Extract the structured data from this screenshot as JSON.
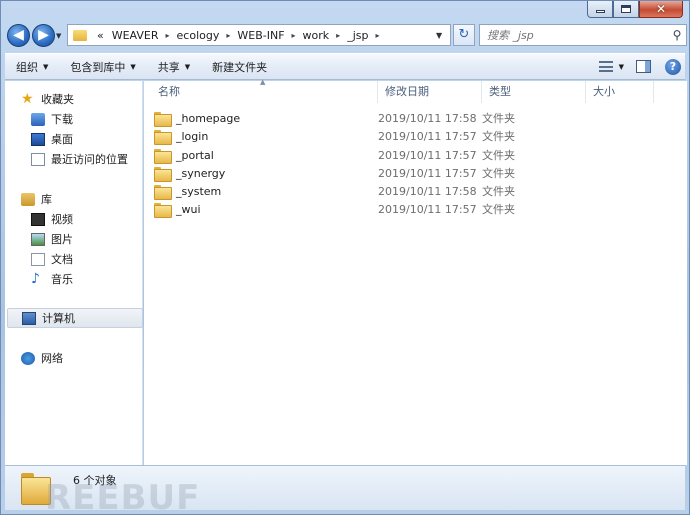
{
  "window": {
    "caption_buttons": {
      "minimize": "minimize",
      "maximize": "maximize",
      "close": "✕"
    }
  },
  "nav": {
    "back_icon": "◀",
    "forward_icon": "▶",
    "chevron": "«",
    "crumbs": [
      "WEAVER",
      "ecology",
      "WEB-INF",
      "work",
      "_jsp"
    ],
    "crumb_sep": "▸",
    "dropdown_icon": "▼",
    "refresh_icon": "↻",
    "search_placeholder": "搜索 _jsp",
    "search_icon": "⚲"
  },
  "toolbar": {
    "organize": "组织",
    "include_in_library": "包含到库中",
    "share": "共享",
    "new_folder": "新建文件夹",
    "dropdown_arrow": "▼",
    "help": "?"
  },
  "sidebar": {
    "favorites": {
      "label": "收藏夹",
      "items": [
        "下载",
        "桌面",
        "最近访问的位置"
      ]
    },
    "libraries": {
      "label": "库",
      "items": [
        "视频",
        "图片",
        "文档",
        "音乐"
      ]
    },
    "computer": "计算机",
    "network": "网络"
  },
  "columns": {
    "name": "名称",
    "modified": "修改日期",
    "type": "类型",
    "size": "大小",
    "sort_indicator": "▲"
  },
  "files": [
    {
      "name": "_homepage",
      "modified": "2019/10/11 17:58",
      "type": "文件夹"
    },
    {
      "name": "_login",
      "modified": "2019/10/11 17:57",
      "type": "文件夹"
    },
    {
      "name": "_portal",
      "modified": "2019/10/11 17:57",
      "type": "文件夹"
    },
    {
      "name": "_synergy",
      "modified": "2019/10/11 17:57",
      "type": "文件夹"
    },
    {
      "name": "_system",
      "modified": "2019/10/11 17:58",
      "type": "文件夹"
    },
    {
      "name": "_wui",
      "modified": "2019/10/11 17:57",
      "type": "文件夹"
    }
  ],
  "status": {
    "count": "6 个对象"
  },
  "watermark": "REEBUF",
  "colors": {
    "accent": "#2a6cc2",
    "folder": "#e8b84a",
    "frame": "#bfd3ea"
  }
}
